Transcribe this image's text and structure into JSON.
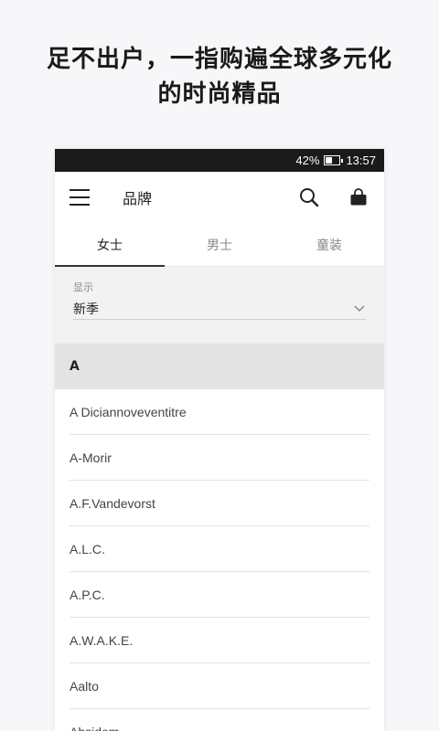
{
  "headline": {
    "line1": "足不出户，一指购遍全球多元化",
    "line2": "的时尚精品"
  },
  "status_bar": {
    "battery": "42%",
    "time": "13:57"
  },
  "app_bar": {
    "title": "品牌",
    "menu_icon": "hamburger-menu-icon",
    "search_icon": "search-icon",
    "bag_icon": "shopping-bag-icon"
  },
  "tabs": [
    {
      "label": "女士",
      "active": true
    },
    {
      "label": "男士",
      "active": false
    },
    {
      "label": "童装",
      "active": false
    }
  ],
  "filter": {
    "label": "显示",
    "value": "新季"
  },
  "section": {
    "letter": "A"
  },
  "brands": [
    "A Diciannoveventitre",
    "A-Morir",
    "A.F.Vandevorst",
    "A.L.C.",
    "A.P.C.",
    "A.W.A.K.E.",
    "Aalto",
    "Absidem"
  ]
}
